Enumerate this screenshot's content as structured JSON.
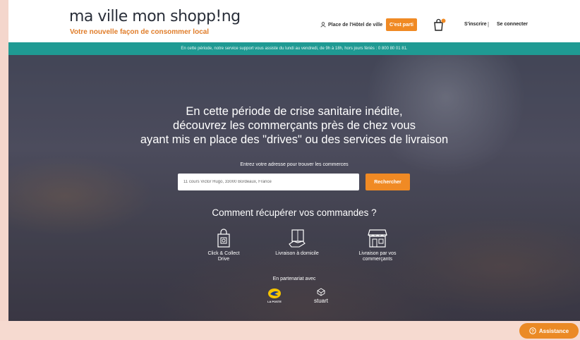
{
  "header": {
    "logo_text": "ma ville mon shopp!ng",
    "tagline": "Votre nouvelle façon de consommer local",
    "location_label": "Place de l'Hôtel de ville",
    "start_button": "C'est parti",
    "signup_label": "S'inscrire",
    "separator": "|",
    "login_label": "Se connecter"
  },
  "infobar": {
    "text": "En cette période, notre service support vous assiste du lundi au vendredi, de 9h à 18h, hors jours fériés : 0 800 80 01 81."
  },
  "hero": {
    "headline_line1": "En cette période de crise sanitaire inédite,",
    "headline_line2": "découvrez les commerçants près de chez vous",
    "headline_line3": "ayant mis en place des \"drives\" ou des services de livraison",
    "address_label": "Entrez votre adresse pour trouver les commerces",
    "address_value": "11 cours Victor Hugo, 33000 Bordeaux, France",
    "search_button": "Rechercher",
    "how_title": "Comment récupérer vos commandes ?",
    "options": [
      {
        "line1": "Click & Collect",
        "line2": "Drive",
        "icon": "click-collect-bag-icon"
      },
      {
        "line1": "Livraison à domicile",
        "line2": "",
        "icon": "home-delivery-icon"
      },
      {
        "line1": "Livraison par vos",
        "line2": "commerçants",
        "icon": "shop-delivery-icon"
      }
    ],
    "partner_label": "En partenariat avec",
    "partner_laposte": "LA POSTE",
    "partner_stuart": "stuart"
  },
  "assistance": {
    "label": "Assistance",
    "icon_glyph": "?"
  },
  "colors": {
    "accent": "#f08a24",
    "infobar": "#1f9a93",
    "tagline": "#e07d2a"
  }
}
